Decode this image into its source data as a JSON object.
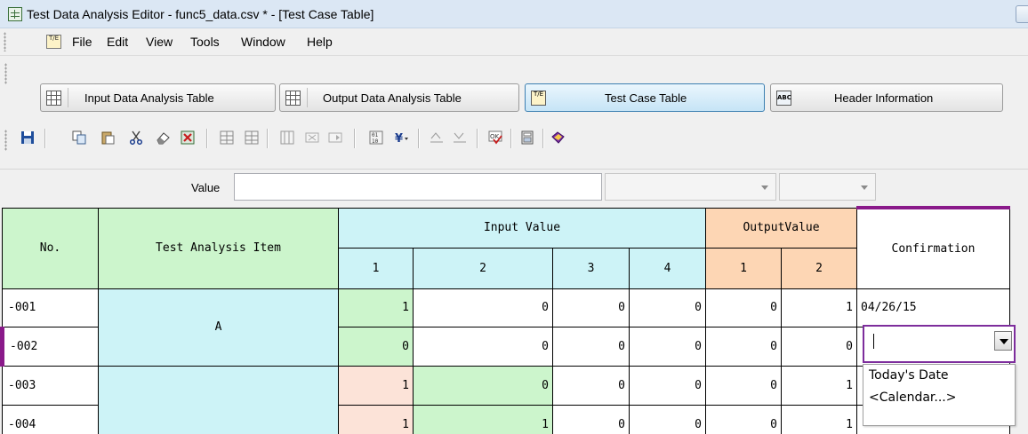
{
  "window": {
    "title": "Test Data Analysis Editor - func5_data.csv * - [Test Case Table]",
    "app_icon": "grid-icon",
    "menu_icon": "test-case-icon",
    "menu_icon_text": "T/E"
  },
  "menu": [
    "File",
    "Edit",
    "View",
    "Tools",
    "Window",
    "Help"
  ],
  "views": [
    {
      "label": "Input Data Analysis Table",
      "icon": "table-icon",
      "active": false
    },
    {
      "label": "Output Data Analysis Table",
      "icon": "table-icon",
      "active": false
    },
    {
      "label": "Test Case Table",
      "icon": "test-case-icon",
      "active": true
    },
    {
      "label": "Header Information",
      "icon": "abc-icon",
      "active": false
    }
  ],
  "toolbar_icons": [
    "save-icon",
    "copy-icon",
    "paste-icon",
    "cut-icon",
    "eraser-icon",
    "delete-icon",
    "insert-row-icon",
    "delete-row-icon",
    "insert-col-icon",
    "shift-left-icon",
    "shift-right-icon",
    "binary-icon",
    "filter-icon",
    "expand-col-icon",
    "shrink-col-icon",
    "ok-check-icon",
    "calculator-icon",
    "book-icon"
  ],
  "value_bar": {
    "label": "Value",
    "value": ""
  },
  "table": {
    "headers": {
      "no": "No.",
      "item": "Test Analysis Item",
      "input": "Input Value",
      "output": "OutputValue",
      "confirmation": "Confirmation",
      "input_cols": [
        "1",
        "2",
        "3",
        "4"
      ],
      "output_cols": [
        "1",
        "2"
      ]
    },
    "rows": [
      {
        "no": "-001",
        "inputs": [
          "1",
          "0",
          "0",
          "0"
        ],
        "outputs": [
          "0",
          "1"
        ],
        "confirmation": "04/26/15"
      },
      {
        "no": "-002",
        "inputs": [
          "0",
          "0",
          "0",
          "0"
        ],
        "outputs": [
          "0",
          "0"
        ],
        "confirmation": ""
      },
      {
        "no": "-003",
        "inputs": [
          "1",
          "0",
          "0",
          "0"
        ],
        "outputs": [
          "0",
          "1"
        ],
        "confirmation": ""
      },
      {
        "no": "-004",
        "inputs": [
          "1",
          "1",
          "0",
          "0"
        ],
        "outputs": [
          "0",
          "1"
        ],
        "confirmation": ""
      }
    ],
    "item_groups": [
      {
        "label": "A",
        "rows": 2
      },
      {
        "label": "",
        "rows": 2
      }
    ]
  },
  "dropdown": {
    "value": "",
    "options": [
      "Today's Date",
      "<Calendar...>"
    ]
  },
  "colors": {
    "input_header": "#cdf3f7",
    "output_header": "#fdd6b4",
    "green_cell": "#ccf5cc",
    "salmon_cell": "#fce3d8",
    "accent_purple": "#8a1a8a"
  }
}
